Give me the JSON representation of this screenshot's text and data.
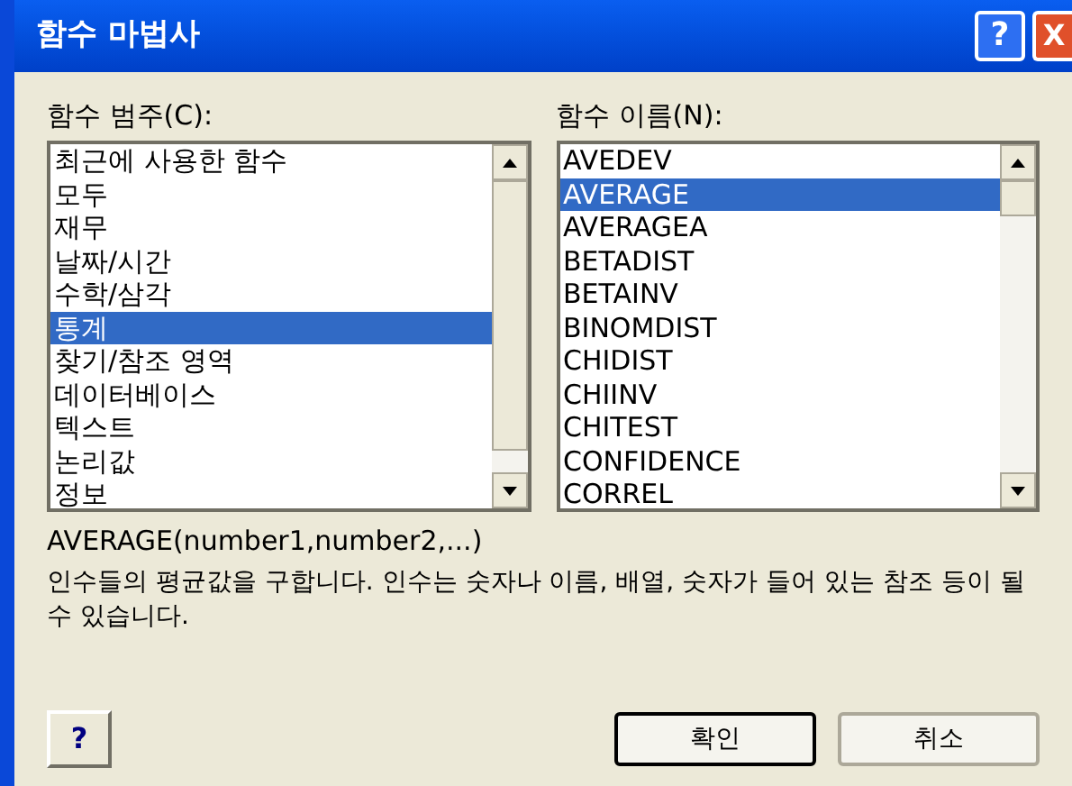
{
  "window": {
    "title": "함수 마법사",
    "help_glyph": "?",
    "close_glyph": "X"
  },
  "category": {
    "label": "함수 범주(C):",
    "items": [
      {
        "label": "최근에 사용한 함수",
        "selected": false
      },
      {
        "label": "모두",
        "selected": false
      },
      {
        "label": "재무",
        "selected": false
      },
      {
        "label": "날짜/시간",
        "selected": false
      },
      {
        "label": "수학/삼각",
        "selected": false
      },
      {
        "label": "통계",
        "selected": true
      },
      {
        "label": "찾기/참조 영역",
        "selected": false
      },
      {
        "label": "데이터베이스",
        "selected": false
      },
      {
        "label": "텍스트",
        "selected": false
      },
      {
        "label": "논리값",
        "selected": false
      },
      {
        "label": "정보",
        "selected": false
      }
    ]
  },
  "function": {
    "label": "함수 이름(N):",
    "items": [
      {
        "label": "AVEDEV",
        "selected": false
      },
      {
        "label": "AVERAGE",
        "selected": true
      },
      {
        "label": "AVERAGEA",
        "selected": false
      },
      {
        "label": "BETADIST",
        "selected": false
      },
      {
        "label": "BETAINV",
        "selected": false
      },
      {
        "label": "BINOMDIST",
        "selected": false
      },
      {
        "label": "CHIDIST",
        "selected": false
      },
      {
        "label": "CHIINV",
        "selected": false
      },
      {
        "label": "CHITEST",
        "selected": false
      },
      {
        "label": "CONFIDENCE",
        "selected": false
      },
      {
        "label": "CORREL",
        "selected": false
      }
    ]
  },
  "syntax": "AVERAGE(number1,number2,...)",
  "description": "인수들의 평균값을 구합니다. 인수는 숫자나 이름, 배열, 숫자가 들어 있는 참조 등이 될 수 있습니다.",
  "help_button": "?",
  "buttons": [
    "확인",
    "취소"
  ]
}
